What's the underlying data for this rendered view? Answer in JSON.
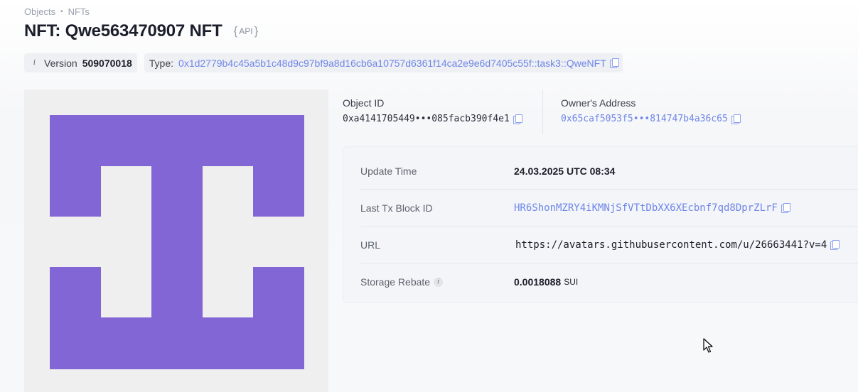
{
  "breadcrumb": {
    "items": [
      "Objects",
      "NFTs"
    ],
    "separator": "•"
  },
  "page": {
    "title": "NFT: Qwe563470907 NFT",
    "api_label": "API",
    "brace_open": "{",
    "brace_close": "}"
  },
  "chips": {
    "version_label": "Version",
    "version_value": "509070018",
    "type_label": "Type:",
    "type_value": "0x1d2779b4c45a5b1c48d9c97bf9a8d16cb6a10757d6361f14ca2e9e6d7405c55f::task3::QweNFT"
  },
  "object": {
    "id_label": "Object ID",
    "id_value": "0xa4141705449•••085facb390f4e1",
    "owner_label": "Owner's Address",
    "owner_value": "0x65caf5053f5•••814747b4a36c65"
  },
  "details": {
    "update_time_label": "Update Time",
    "update_time_value": "24.03.2025 UTC 08:34",
    "last_tx_label": "Last Tx Block ID",
    "last_tx_value": "HR6ShonMZRY4iKMNjSfVTtDbXX6XEcbnf7qd8DprZLrF",
    "url_label": "URL",
    "url_value": "https://avatars.githubusercontent.com/u/26663441?v=4",
    "storage_label": "Storage Rebate",
    "storage_value": "0.0018088",
    "storage_unit": "SUI"
  },
  "colors": {
    "accent_link": "#6f86e8",
    "nft_purple": "#8366d6",
    "nft_background": "#efefef"
  }
}
